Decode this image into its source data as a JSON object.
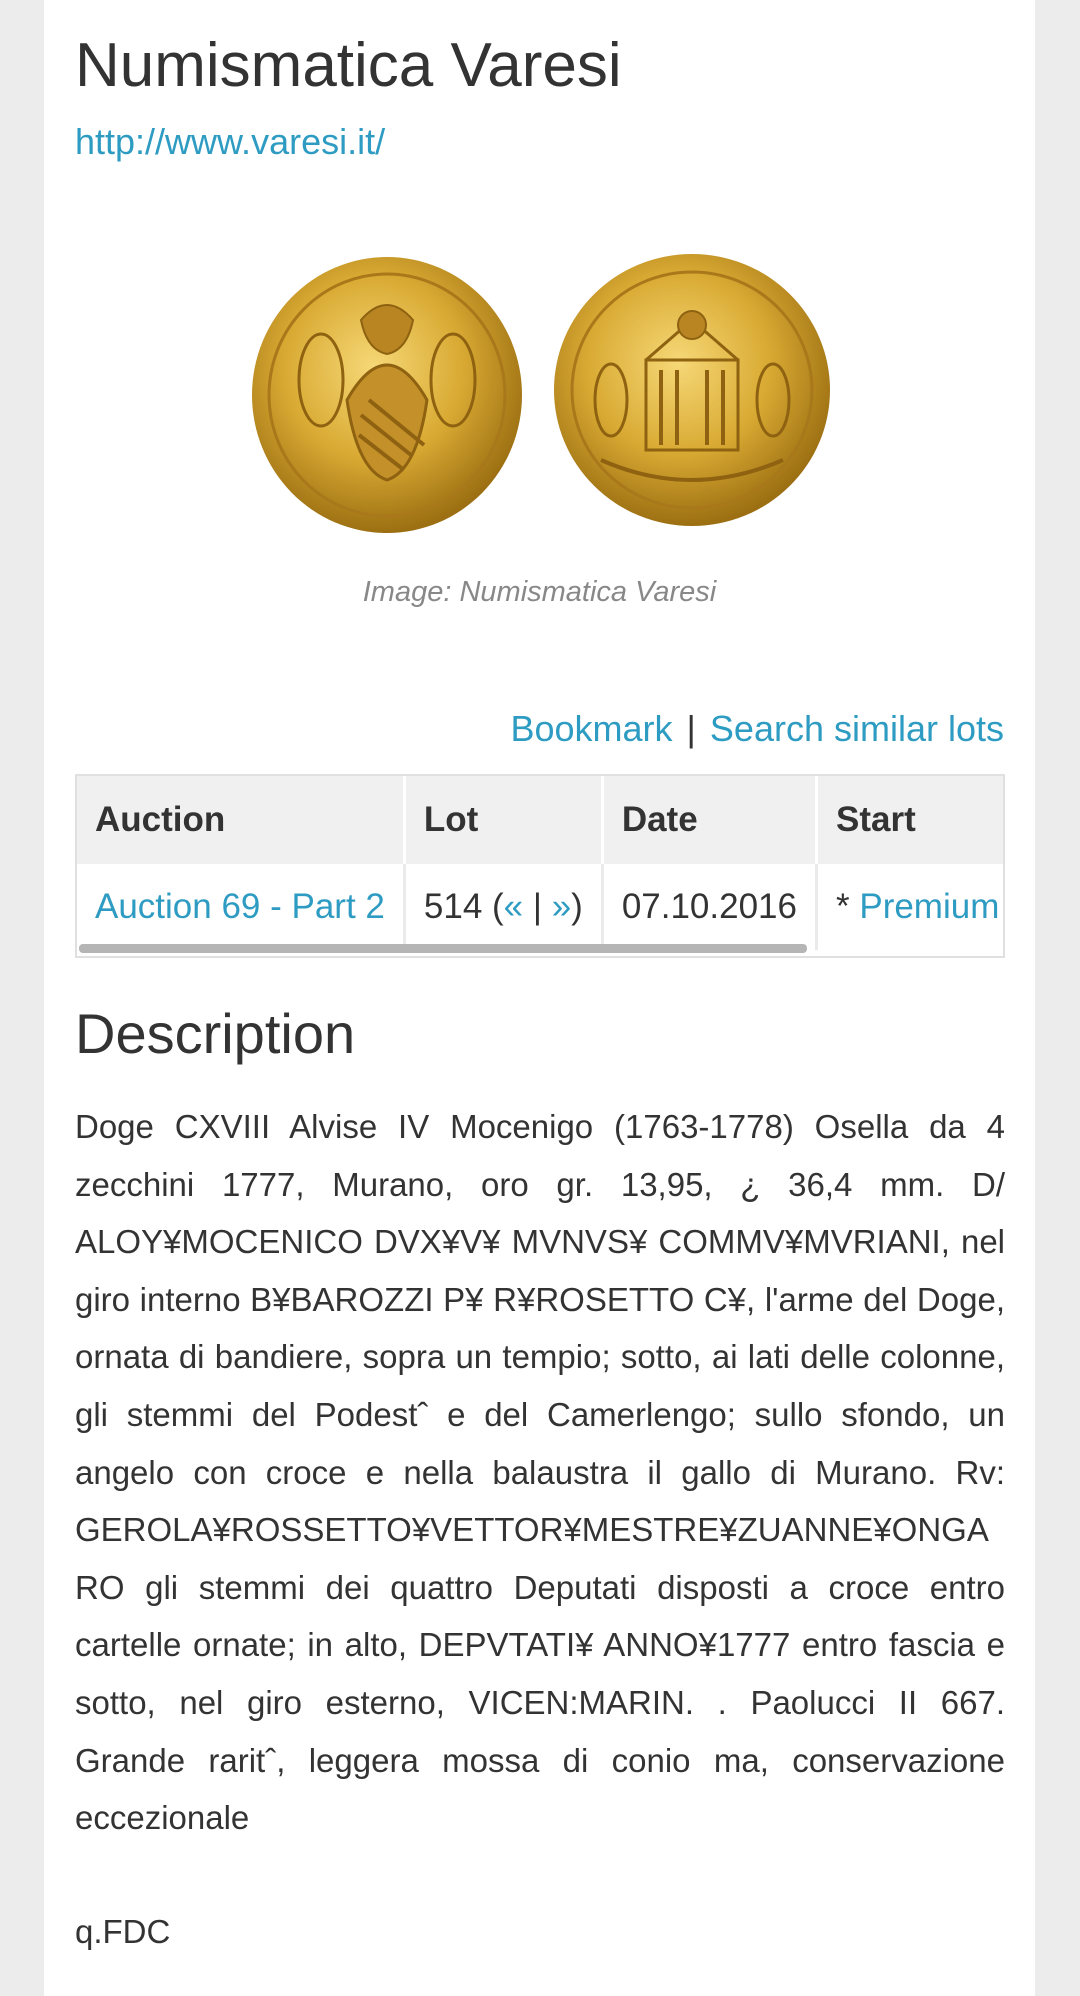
{
  "header": {
    "title": "Numismatica Varesi",
    "url": "http://www.varesi.it/"
  },
  "image": {
    "caption": "Image: Numismatica Varesi",
    "coin_color": "#d9b040"
  },
  "actions": {
    "bookmark": "Bookmark",
    "separator": "|",
    "search_similar": "Search similar lots"
  },
  "table": {
    "headers": [
      "Auction",
      "Lot",
      "Date",
      "Start"
    ],
    "row": {
      "auction": "Auction 69 - Part 2",
      "lot_number": "514 (",
      "prev": "«",
      "lot_sep": " | ",
      "next": "»",
      "lot_close": ")",
      "date": "07.10.2016",
      "start_prefix": "* ",
      "start_link": "Premium"
    }
  },
  "description": {
    "heading": "Description",
    "text": "Doge CXVIII Alvise IV Mocenigo (1763-1778) Osella da 4 zecchini 1777, Murano, oro gr. 13,95, ¿ 36,4 mm. D/ ALOY¥MOCENICO DVX¥V¥ MVNVS¥ COMMV¥MVRIANI, nel giro interno B¥BAROZZI P¥ R¥ROSETTO C¥, l'arme del Doge, ornata di bandiere, sopra un tempio; sotto, ai lati delle colonne, gli stemmi del Podestˆ e del Camerlengo; sullo sfondo, un angelo con croce e nella balaustra il gallo di Murano. Rv: GEROLA¥ROSSETTO¥VETTOR¥MESTRE¥ZUANNE¥ONGARO gli stemmi dei quattro Deputati disposti a croce entro cartelle ornate; in alto, DEPVTATI¥ ANNO¥1777 entro fascia e sotto, nel giro esterno, VICEN:MARIN. . Paolucci II 667. Grande raritˆ, leggera mossa di conio ma, conservazione eccezionale",
    "grade": "q.FDC"
  }
}
